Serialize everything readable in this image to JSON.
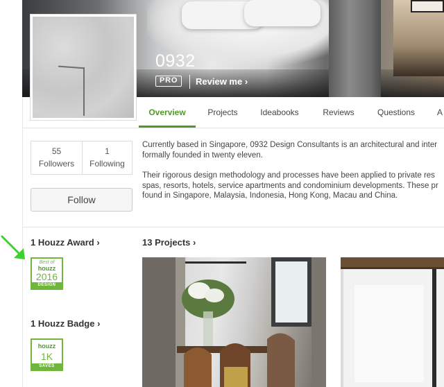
{
  "profile": {
    "name": "0932",
    "pro_label": "PRO",
    "review_label": "Review me",
    "chevron": "›"
  },
  "tabs": [
    {
      "label": "Overview",
      "active": true
    },
    {
      "label": "Projects",
      "active": false
    },
    {
      "label": "Ideabooks",
      "active": false
    },
    {
      "label": "Reviews",
      "active": false
    },
    {
      "label": "Questions",
      "active": false
    },
    {
      "label": "A",
      "active": false
    }
  ],
  "stats": {
    "followers_count": "55",
    "followers_label": "Followers",
    "following_count": "1",
    "following_label": "Following"
  },
  "follow_button": "Follow",
  "about": {
    "p1_line1": "Currently based in Singapore, 0932 Design Consultants is an architectural and inter",
    "p1_line2": "formally founded in twenty eleven.",
    "p2_line1": "Their rigorous design methodology and processes have been applied to private res",
    "p2_line2": "spas, resorts, hotels, service apartments and condominium developments. These pr",
    "p2_line3": "found in Singapore, Malaysia, Indonesia, Hong Kong, Macau and China."
  },
  "awards": {
    "title": "1 Houzz Award",
    "badge_top": "Best of",
    "badge_brand": "houzz",
    "badge_year": "2016",
    "badge_bottom": "DESIGN"
  },
  "badges": {
    "title": "1 Houzz Badge",
    "badge_brand": "houzz",
    "badge_value": "1K",
    "badge_bottom": "SAVES"
  },
  "projects": {
    "title": "13 Projects"
  },
  "colors": {
    "accent": "#4d9b26",
    "badge_green": "#6fb63a",
    "arrow_green": "#3fcf2f"
  }
}
